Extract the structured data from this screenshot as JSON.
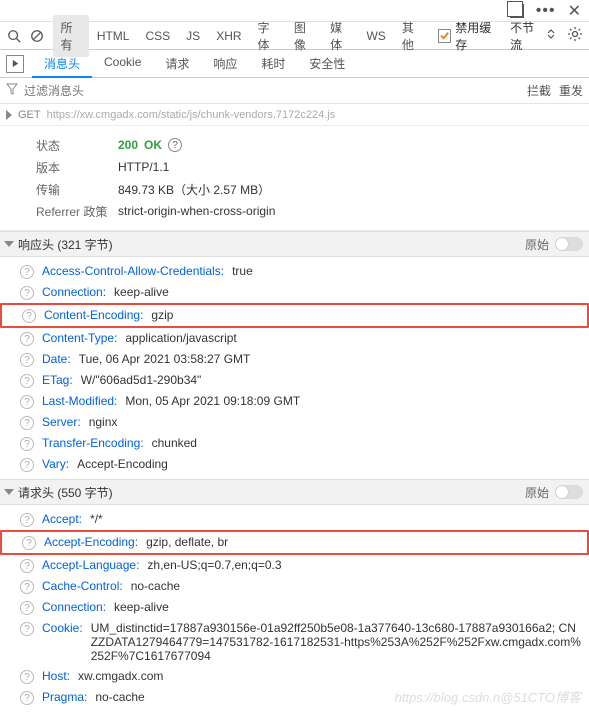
{
  "topbar": {
    "dots": "•••",
    "close": "✕"
  },
  "toolbar": {
    "tabs": [
      "所有",
      "HTML",
      "CSS",
      "JS",
      "XHR",
      "字体",
      "图像",
      "媒体",
      "WS",
      "其他"
    ],
    "active": 0,
    "cache_label": "禁用缓存",
    "throttle_label": "不节流"
  },
  "subtabs": {
    "items": [
      "消息头",
      "Cookie",
      "请求",
      "响应",
      "耗时",
      "安全性"
    ],
    "active": 0
  },
  "filter": {
    "placeholder": "过滤消息头",
    "block": "拦截",
    "resend": "重发"
  },
  "request": {
    "method": "GET",
    "url": "https://xw.cmgadx.com/static/js/chunk-vendors.7172c224.js"
  },
  "meta": {
    "status_label": "状态",
    "status_code": "200",
    "status_text": "OK",
    "version_label": "版本",
    "version_val": "HTTP/1.1",
    "transfer_label": "传输",
    "transfer_val": "849.73 KB（大小 2.57 MB）",
    "referrer_label": "Referrer 政策",
    "referrer_val": "strict-origin-when-cross-origin"
  },
  "response_section": {
    "title": "响应头 (321 字节)",
    "raw_label": "原始"
  },
  "response_headers": [
    {
      "name": "Access-Control-Allow-Credentials:",
      "value": "true"
    },
    {
      "name": "Connection:",
      "value": "keep-alive"
    },
    {
      "name": "Content-Encoding:",
      "value": "gzip",
      "highlight": true
    },
    {
      "name": "Content-Type:",
      "value": "application/javascript"
    },
    {
      "name": "Date:",
      "value": "Tue, 06 Apr 2021 03:58:27 GMT"
    },
    {
      "name": "ETag:",
      "value": "W/\"606ad5d1-290b34\""
    },
    {
      "name": "Last-Modified:",
      "value": "Mon, 05 Apr 2021 09:18:09 GMT"
    },
    {
      "name": "Server:",
      "value": "nginx"
    },
    {
      "name": "Transfer-Encoding:",
      "value": "chunked"
    },
    {
      "name": "Vary:",
      "value": "Accept-Encoding"
    }
  ],
  "request_section": {
    "title": "请求头 (550 字节)",
    "raw_label": "原始"
  },
  "request_headers": [
    {
      "name": "Accept:",
      "value": "*/*"
    },
    {
      "name": "Accept-Encoding:",
      "value": "gzip, deflate, br",
      "highlight": true
    },
    {
      "name": "Accept-Language:",
      "value": "zh,en-US;q=0.7,en;q=0.3"
    },
    {
      "name": "Cache-Control:",
      "value": "no-cache"
    },
    {
      "name": "Connection:",
      "value": "keep-alive"
    },
    {
      "name": "Cookie:",
      "value": "UM_distinctid=17887a930156e-01a92ff250b5e08-1a377640-13c680-17887a930166a2; CNZZDATA1279464779=147531782-1617182531-https%253A%252F%252Fxw.cmgadx.com%252F%7C1617677094"
    },
    {
      "name": "Host:",
      "value": "xw.cmgadx.com"
    },
    {
      "name": "Pragma:",
      "value": "no-cache"
    }
  ],
  "watermark": "https://blog.csdn.n@51CTO博客"
}
